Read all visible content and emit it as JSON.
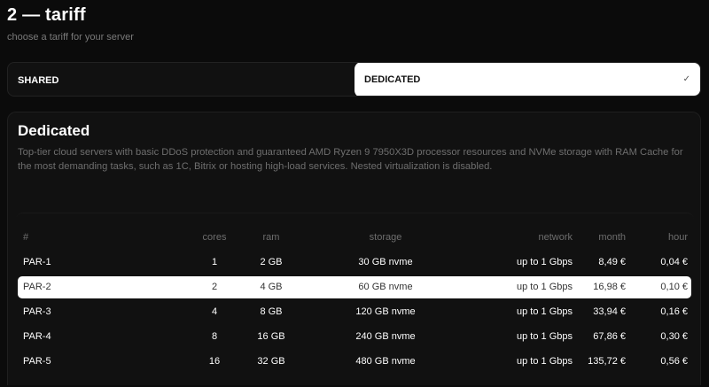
{
  "step": {
    "title": "2 — tariff",
    "subtitle": "choose a tariff for your server"
  },
  "tabs": [
    {
      "label": "SHARED",
      "selected": false
    },
    {
      "label": "DEDICATED",
      "selected": true,
      "check": "✓"
    }
  ],
  "panel": {
    "title": "Dedicated",
    "description": "Top-tier cloud servers with basic DDoS protection and guaranteed AMD Ryzen 9 7950X3D processor resources and NVMe storage with RAM Cache for the most demanding tasks, such as 1C, Bitrix or hosting high-load services. Nested virtualization is disabled."
  },
  "table": {
    "headers": {
      "name": "#",
      "cores": "cores",
      "ram": "ram",
      "storage": "storage",
      "network": "network",
      "month": "month",
      "hour": "hour"
    },
    "rows": [
      {
        "name": "PAR-1",
        "cores": "1",
        "ram": "2 GB",
        "storage": "30 GB nvme",
        "network": "up to 1 Gbps",
        "month": "8,49 €",
        "hour": "0,04 €",
        "selected": false
      },
      {
        "name": "PAR-2",
        "cores": "2",
        "ram": "4 GB",
        "storage": "60 GB nvme",
        "network": "up to 1 Gbps",
        "month": "16,98 €",
        "hour": "0,10 €",
        "selected": true
      },
      {
        "name": "PAR-3",
        "cores": "4",
        "ram": "8 GB",
        "storage": "120 GB nvme",
        "network": "up to 1 Gbps",
        "month": "33,94 €",
        "hour": "0,16 €",
        "selected": false
      },
      {
        "name": "PAR-4",
        "cores": "8",
        "ram": "16 GB",
        "storage": "240 GB nvme",
        "network": "up to 1 Gbps",
        "month": "67,86 €",
        "hour": "0,30 €",
        "selected": false
      },
      {
        "name": "PAR-5",
        "cores": "16",
        "ram": "32 GB",
        "storage": "480 GB nvme",
        "network": "up to 1 Gbps",
        "month": "135,72 €",
        "hour": "0,56 €",
        "selected": false
      }
    ]
  },
  "colors": {
    "background": "#0b0b0b",
    "panel": "#111111",
    "selected_bg": "#ffffff",
    "muted_text": "#6e6e6e"
  }
}
